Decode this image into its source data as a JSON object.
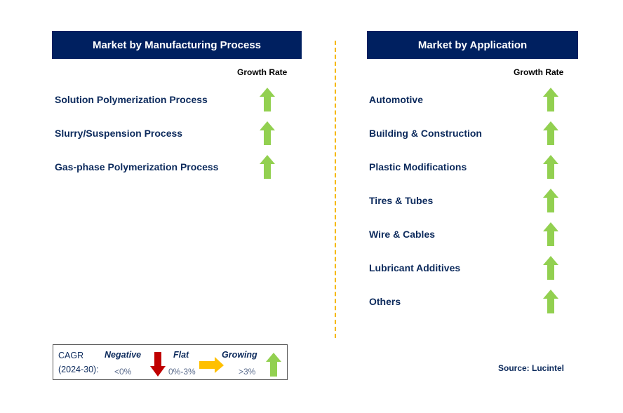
{
  "left_panel": {
    "title": "Market by Manufacturing Process",
    "growth_label": "Growth Rate",
    "items": [
      {
        "label": "Solution Polymerization Process",
        "trend": "growing"
      },
      {
        "label": "Slurry/Suspension Process",
        "trend": "growing"
      },
      {
        "label": "Gas-phase Polymerization Process",
        "trend": "growing"
      }
    ]
  },
  "right_panel": {
    "title": "Market by Application",
    "growth_label": "Growth Rate",
    "items": [
      {
        "label": "Automotive",
        "trend": "growing"
      },
      {
        "label": "Building & Construction",
        "trend": "growing"
      },
      {
        "label": "Plastic Modifications",
        "trend": "growing"
      },
      {
        "label": "Tires & Tubes",
        "trend": "growing"
      },
      {
        "label": "Wire & Cables",
        "trend": "growing"
      },
      {
        "label": "Lubricant Additives",
        "trend": "growing"
      },
      {
        "label": "Others",
        "trend": "growing"
      }
    ]
  },
  "legend": {
    "cagr": "CAGR",
    "period": "(2024-30):",
    "negative": "Negative",
    "negative_range": "<0%",
    "flat": "Flat",
    "flat_range": "0%-3%",
    "growing": "Growing",
    "growing_range": ">3%"
  },
  "source": "Source: Lucintel",
  "colors": {
    "header": "#002060",
    "growing": "#92D050",
    "negative": "#C00000",
    "flat": "#FFC000",
    "divider": "#F5B800"
  }
}
